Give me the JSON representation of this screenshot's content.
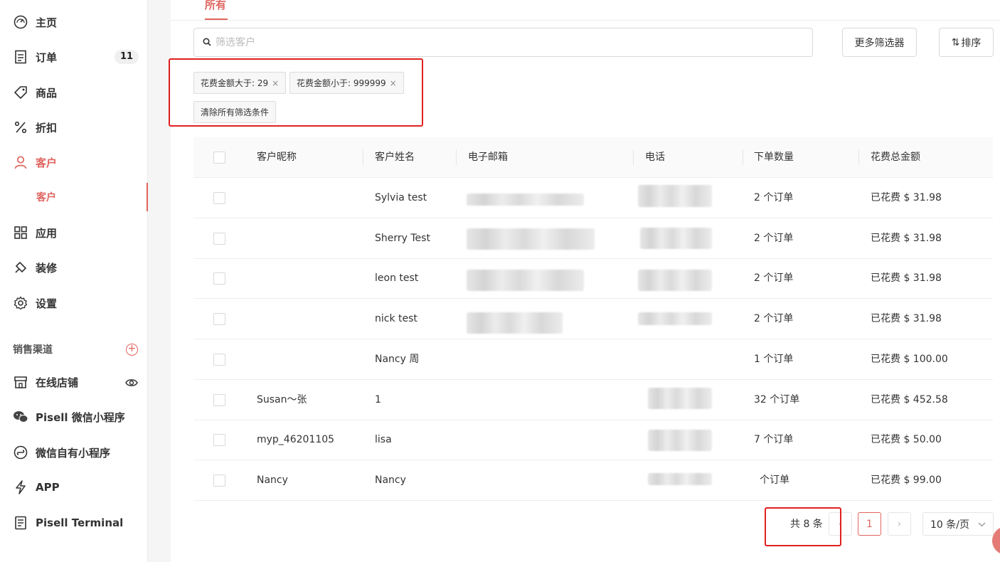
{
  "sidebar": {
    "items": [
      {
        "label": "主页",
        "icon": "dashboard-icon"
      },
      {
        "label": "订单",
        "icon": "orders-icon",
        "badge": "11"
      },
      {
        "label": "商品",
        "icon": "tag-icon"
      },
      {
        "label": "折扣",
        "icon": "percent-icon"
      },
      {
        "label": "客户",
        "icon": "user-icon"
      },
      {
        "label": "客户",
        "icon": ""
      },
      {
        "label": "应用",
        "icon": "apps-icon"
      },
      {
        "label": "装修",
        "icon": "brush-icon"
      },
      {
        "label": "设置",
        "icon": "gear-icon"
      }
    ],
    "channels_label": "销售渠道",
    "channels": [
      {
        "label": "在线店铺",
        "icon": "store-icon"
      },
      {
        "label": "Pisell 微信小程序",
        "icon": "wechat-icon"
      },
      {
        "label": "微信自有小程序",
        "icon": "miniprogram-icon"
      },
      {
        "label": "APP",
        "icon": "lightning-icon"
      },
      {
        "label": "Pisell Terminal",
        "icon": "terminal-icon"
      }
    ],
    "accent_color": "#e0645f"
  },
  "main": {
    "tab_all": "所有",
    "search_placeholder": "筛选客户",
    "more_filters": "更多筛选器",
    "sort": "排序",
    "filter_tags": [
      "花费金额大于: 29",
      "花费金额小于: 999999"
    ],
    "clear_filters": "清除所有筛选条件",
    "table": {
      "headers": [
        "客户昵称",
        "客户姓名",
        "电子邮箱",
        "电话",
        "下单数量",
        "花费总金额"
      ],
      "rows": [
        {
          "nickname": "",
          "name": "Sylvia test",
          "orders": "2 个订单",
          "spent": "已花费 $ 31.98"
        },
        {
          "nickname": "",
          "name": "Sherry Test",
          "orders": "2 个订单",
          "spent": "已花费 $ 31.98"
        },
        {
          "nickname": "",
          "name": "leon test",
          "orders": "2 个订单",
          "spent": "已花费 $ 31.98"
        },
        {
          "nickname": "",
          "name": "nick test",
          "orders": "2 个订单",
          "spent": "已花费 $ 31.98"
        },
        {
          "nickname": "",
          "name": "Nancy 周",
          "orders": "1 个订单",
          "spent": "已花费 $ 100.00"
        },
        {
          "nickname": "Susan～张",
          "name": "1",
          "orders": "32 个订单",
          "spent": "已花费 $ 452.58"
        },
        {
          "nickname": "myp_46201105",
          "name": "lisa",
          "orders": "7 个订单",
          "spent": "已花费 $ 50.00"
        },
        {
          "nickname": "Nancy",
          "name": "Nancy",
          "orders": "个订单",
          "spent": "已花费 $ 99.00"
        }
      ]
    },
    "pagination": {
      "total": "共 8 条",
      "prev": "‹",
      "current": "1",
      "next": "›",
      "page_size": "10 条/页"
    }
  }
}
